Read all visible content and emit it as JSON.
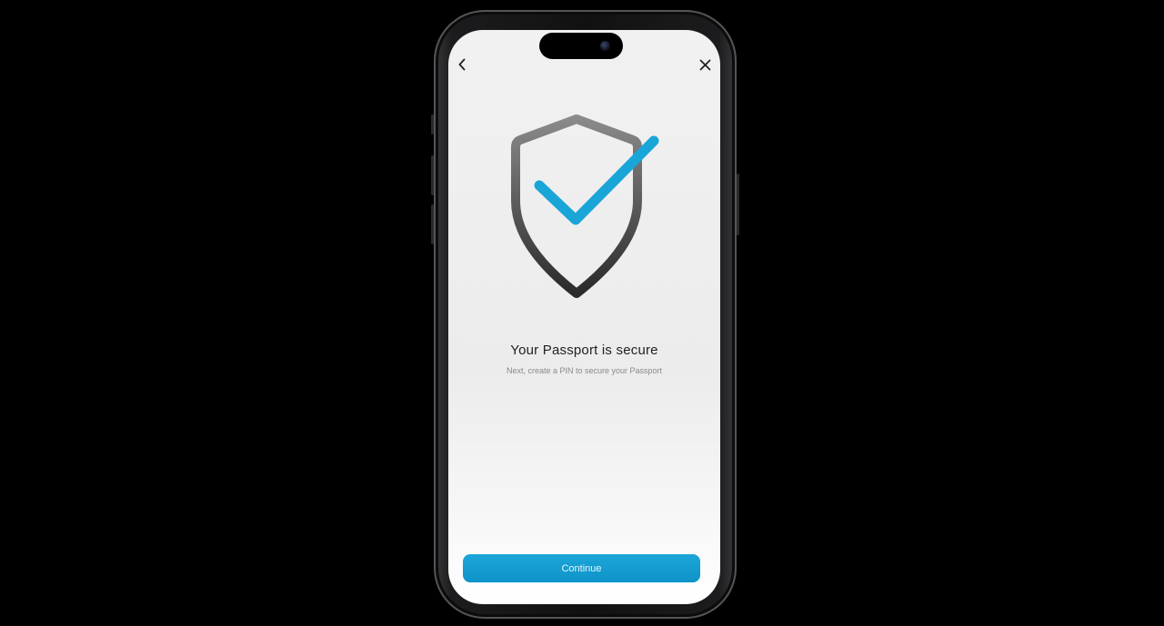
{
  "screen": {
    "title": "Your Passport is secure",
    "subtitle": "Next, create a PIN to secure your Passport",
    "continue_label": "Continue"
  },
  "icons": {
    "back": "chevron-left-icon",
    "close": "close-icon",
    "hero": "shield-check-icon"
  },
  "colors": {
    "accent": "#0e9ad0",
    "check": "#1aa5d8",
    "shield_top": "#8a8a8a",
    "shield_bottom": "#2a2a2a",
    "title_text": "#222222",
    "subtitle_text": "#8a8a8a"
  }
}
